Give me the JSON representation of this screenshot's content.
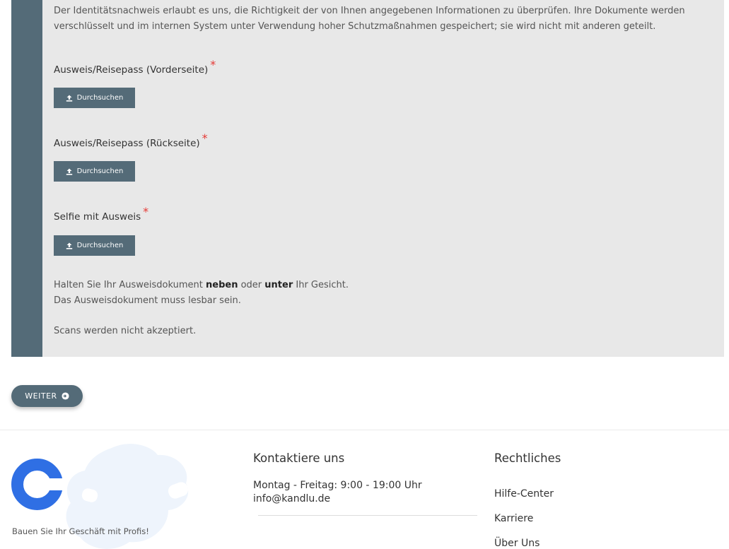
{
  "verification": {
    "intro": "Der Identitätsnachweis erlaubt es uns, die Richtigkeit der von Ihnen angegebenen Informationen zu überprüfen. Ihre Dokumente werden verschlüsselt und im internen System unter Verwendung hoher Schutzmaßnahmen gespeichert; sie wird nicht mit anderen geteilt.",
    "required_mark": "*",
    "fields": [
      {
        "label": "Ausweis/Reisepass (Vorderseite)",
        "button_label": "Durchsuchen"
      },
      {
        "label": "Ausweis/Reisepass (Rückseite)",
        "button_label": "Durchsuchen"
      },
      {
        "label": "Selfie mit Ausweis",
        "button_label": "Durchsuchen"
      }
    ],
    "note": {
      "part1": "Halten Sie Ihr Ausweisdokument ",
      "bold1": "neben",
      "part2": " oder ",
      "bold2": "unter",
      "part3": " Ihr Gesicht.",
      "line2": "Das Ausweisdokument muss lesbar sein.",
      "line3": "Scans werden nicht akzeptiert."
    }
  },
  "actions": {
    "next_label": "WEITER"
  },
  "footer": {
    "tagline": "Bauen Sie Ihr Geschäft mit Profis!",
    "contact": {
      "title": "Kontaktiere uns",
      "hours": "Montag - Freitag: 9:00 - 19:00 Uhr",
      "email": "info@kandlu.de"
    },
    "legal": {
      "title": "Rechtliches",
      "links": [
        "Hilfe-Center",
        "Karriere",
        "Über Uns"
      ]
    }
  },
  "colors": {
    "primary": "#546b78",
    "panel_bg": "#e8e8e8",
    "required": "#e53935",
    "logo_blue": "#2f6fe4",
    "blob": "#eef4fc"
  }
}
